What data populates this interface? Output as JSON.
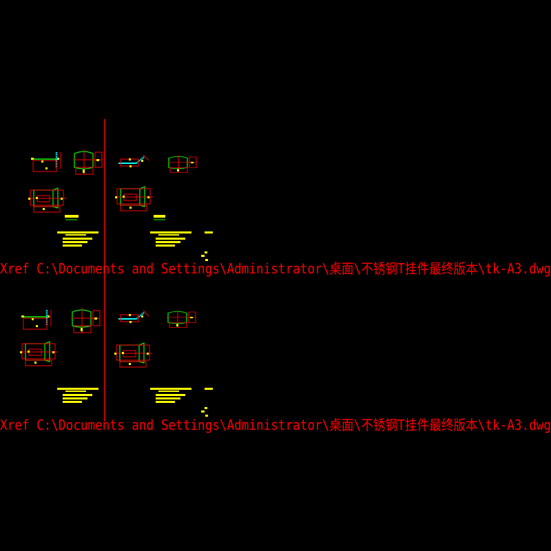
{
  "viewport": {
    "background": "#000000",
    "colors": {
      "dimension": "#ff0000",
      "outline": "#00ff00",
      "steel": "#00ffff",
      "text": "#ffff00",
      "xref": "#ff0000"
    }
  },
  "xref_labels": [
    {
      "text": "Xref C:\\Documents and Settings\\Administrator\\桌面\\不锈钢T挂件最终版本\\tk-A3.dwg"
    },
    {
      "text": "Xref C:\\Documents and Settings\\Administrator\\桌面\\不锈钢T挂件最终版本\\tk-A3.dwg"
    }
  ]
}
